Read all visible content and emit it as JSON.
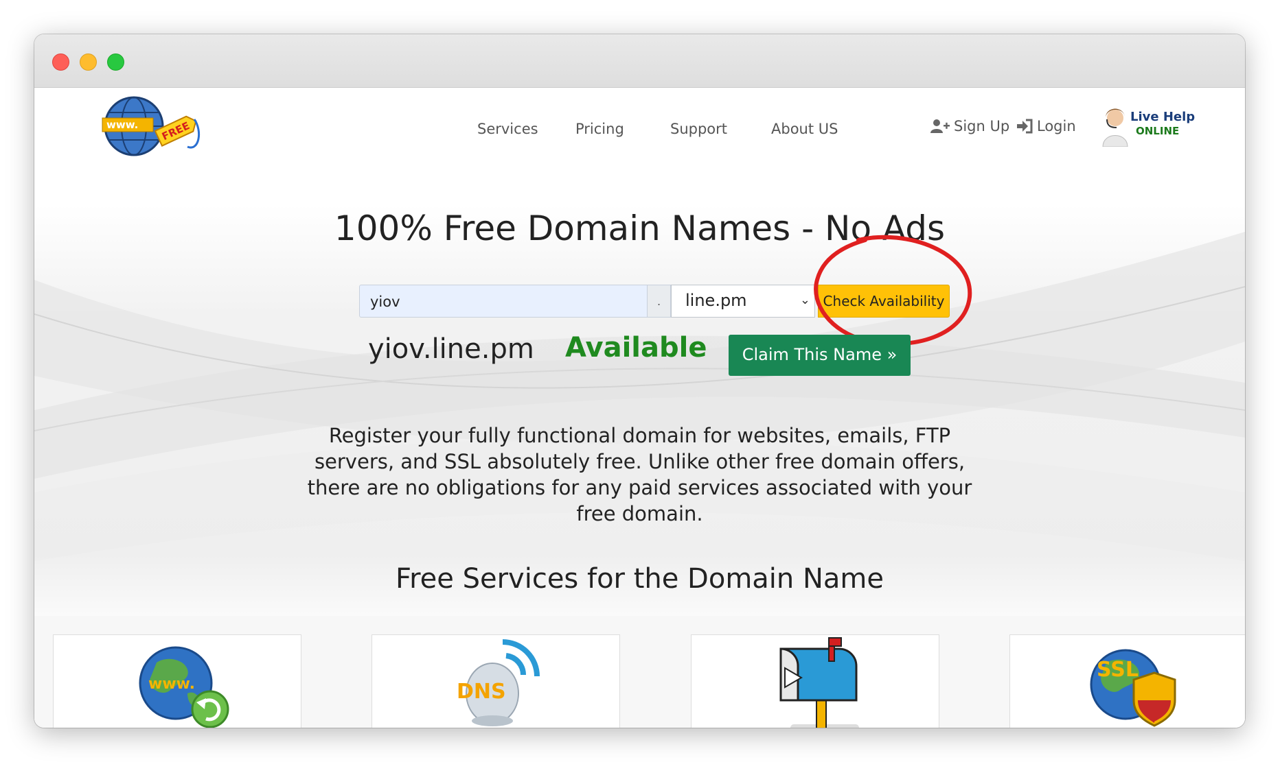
{
  "window": {
    "traffic_lights": [
      "close",
      "minimize",
      "zoom"
    ]
  },
  "header": {
    "logo": {
      "text": "www.",
      "tag_text": "FREE"
    },
    "nav": [
      {
        "label": "Services"
      },
      {
        "label": "Pricing"
      },
      {
        "label": "Support"
      },
      {
        "label": "About US"
      }
    ],
    "sign_up_label": "Sign Up",
    "login_label": "Login",
    "live_help": {
      "line1": "Live Help",
      "line2": "ONLINE"
    }
  },
  "hero": {
    "headline": "100% Free Domain Names - No Ads",
    "search": {
      "domain_value": "yiov",
      "separator": ".",
      "tld_selected": "line.pm",
      "check_button": "Check Availability"
    },
    "result": {
      "domain": "yiov.line.pm",
      "status": "Available",
      "status_color": "#1f8a1f",
      "claim_button": "Claim This Name »"
    },
    "description": "Register your fully functional domain for websites, emails, FTP servers, and SSL absolutely free. Unlike other free domain offers, there are no obligations for any paid services associated with your free domain."
  },
  "services": {
    "title": "Free Services for the Domain Name",
    "cards": [
      {
        "icon": "www-globe-icon",
        "icon_text": "www."
      },
      {
        "icon": "dns-icon",
        "icon_text": "DNS"
      },
      {
        "icon": "mailbox-icon"
      },
      {
        "icon": "ssl-shield-icon",
        "icon_text": "SSL"
      }
    ]
  },
  "colors": {
    "accent_yellow": "#ffc107",
    "claim_green": "#198754",
    "annotation_red": "#e02020"
  }
}
